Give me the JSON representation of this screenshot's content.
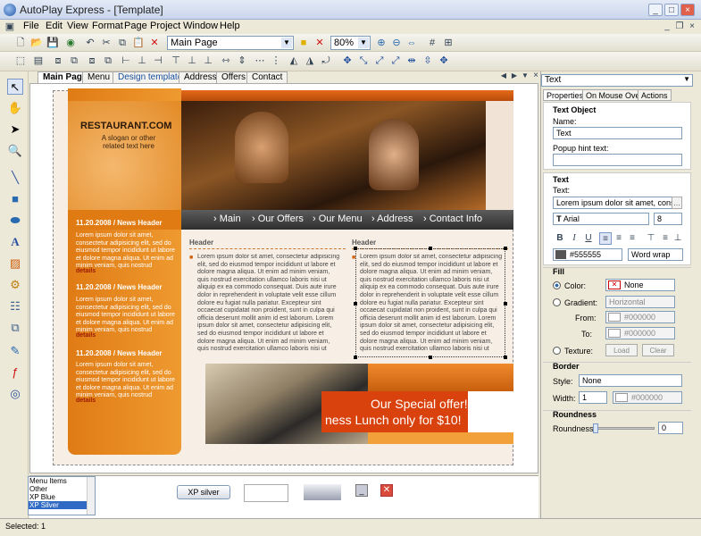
{
  "window": {
    "title": "AutoPlay Express - [Template]"
  },
  "menu": [
    "File",
    "Edit",
    "View",
    "Format",
    "Page",
    "Project",
    "Window",
    "Help"
  ],
  "toolbar": {
    "page_select": "Main Page",
    "zoom": "80%"
  },
  "tabs": [
    "Main Page",
    "Menu",
    "Design template",
    "Address",
    "Offers",
    "Contact"
  ],
  "page": {
    "logo_title": "RESTAURANT.COM",
    "logo_slogan": "A slogan or other related text here",
    "nav": [
      "Main",
      "Our Offers",
      "Our Menu",
      "Address",
      "Contact Info"
    ],
    "news": [
      {
        "header": "11.20.2008 / News Header",
        "text": "Lorem ipsum dolor sit amet, consectetur adipisicing elit, sed do eiusmod tempor incididunt ut labore et dolore magna aliqua. Ut enim ad minim veniam, quis nostrud",
        "link": "details"
      },
      {
        "header": "11.20.2008 / News Header",
        "text": "Lorem ipsum dolor sit amet, consectetur adipisicing elit, sed do eiusmod tempor incididunt ut labore et dolore magna aliqua. Ut enim ad minim veniam, quis nostrud",
        "link": "details"
      },
      {
        "header": "11.20.2008 / News Header",
        "text": "Lorem ipsum dolor sit amet, consectetur adipisicing elit, sed do eiusmod tempor incididunt ut labore et dolore magna aliqua. Ut enim ad minim veniam, quis nostrud",
        "link": "details"
      }
    ],
    "col1": {
      "header": "Header",
      "text": "Lorem ipsum dolor sit amet, consectetur adipisicing elit, sed do eiusmod tempor incididunt ut labore et dolore magna aliqua. Ut enim ad minim veniam, quis nostrud exercitation ullamco laboris nisi ut aliquip ex ea commodo consequat. Duis aute irure dolor in reprehenderit in voluptate velit esse cillum dolore eu fugiat nulla pariatur. Excepteur sint occaecat cupidatat non proident, sunt in culpa qui officia deserunt mollit anim id est laborum. Lorem ipsum dolor sit amet, consectetur adipisicing elit, sed do eiusmod tempor incididunt ut labore et dolore magna aliqua. Ut enim ad minim veniam, quis nostrud exercitation ullamco laboris nisi ut aliquip ex ea"
    },
    "col2": {
      "header": "Header",
      "text": "Lorem ipsum dolor sit amet, consectetur adipisicing elit, sed do eiusmod tempor incididunt ut labore et dolore magna aliqua. Ut enim ad minim veniam, quis nostrud exercitation ullamco laboris nisi ut aliquip ex ea commodo consequat. Duis aute irure dolor in reprehenderit in voluptate velit esse cillum dolore eu fugiat nulla pariatur. Excepteur sint occaecat cupidatat non proident, sunt in culpa qui officia deserunt mollit anim id est laborum. Lorem ipsum dolor sit amet, consectetur adipisicing elit, sed do eiusmod tempor incididunt ut labore et dolore magna aliqua. Ut enim ad minim veniam, quis nostrud exercitation ullamco laboris nisi ut aliquip ex ea"
    },
    "offer_line1": "Our Special offer!",
    "offer_line2": "ness Lunch only for $10!"
  },
  "panel": {
    "object_select": "Text",
    "tabs": [
      "Properties",
      "On Mouse Over",
      "Actions"
    ],
    "text_object": {
      "heading": "Text Object",
      "name_label": "Name:",
      "name_value": "Text",
      "hint_label": "Popup hint text:",
      "hint_value": ""
    },
    "text": {
      "heading": "Text",
      "text_label": "Text:",
      "text_value": "Lorem ipsum dolor sit amet, consectet",
      "font": "Arial",
      "size": "8",
      "color": "#555555",
      "wrap": "Word wrap"
    },
    "fill": {
      "heading": "Fill",
      "color_label": "Color:",
      "color_value": "None",
      "gradient_label": "Gradient:",
      "gradient_value": "Horizontal",
      "from_label": "From:",
      "from_value": "#000000",
      "to_label": "To:",
      "to_value": "#000000",
      "texture_label": "Texture:",
      "load": "Load",
      "clear": "Clear"
    },
    "border": {
      "heading": "Border",
      "style_label": "Style:",
      "style_value": "None",
      "width_label": "Width:",
      "width_value": "1",
      "color_value": "#000000"
    },
    "roundness": {
      "heading": "Roundness",
      "label": "Roundness:",
      "value": "0"
    }
  },
  "styles": {
    "items": [
      "Menu Items",
      "Other",
      "XP Blue",
      "XP Silver"
    ],
    "selected": "XP Silver",
    "button_label": "XP silver"
  },
  "status": {
    "text": "Selected: 1"
  }
}
